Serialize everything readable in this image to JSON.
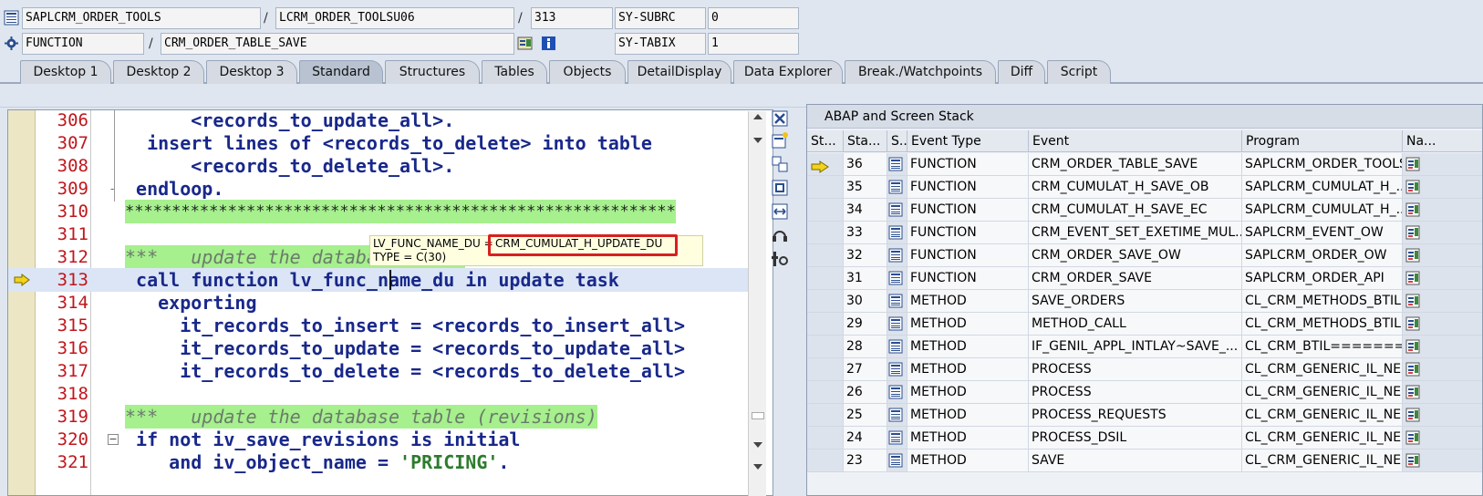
{
  "header": {
    "program": "SAPLCRM_ORDER_TOOLS",
    "include": "LCRM_ORDER_TOOLSU06",
    "line": "313",
    "subrc_label": "SY-SUBRC",
    "subrc_value": "0",
    "event_type": "FUNCTION",
    "event_name": "CRM_ORDER_TABLE_SAVE",
    "tabix_label": "SY-TABIX",
    "tabix_value": "1",
    "slash": "/"
  },
  "tabs": [
    {
      "label": "Desktop 1",
      "active": false
    },
    {
      "label": "Desktop 2",
      "active": false
    },
    {
      "label": "Desktop 3",
      "active": false
    },
    {
      "label": "Standard",
      "active": true
    },
    {
      "label": "Structures",
      "active": false
    },
    {
      "label": "Tables",
      "active": false
    },
    {
      "label": "Objects",
      "active": false
    },
    {
      "label": "DetailDisplay",
      "active": false
    },
    {
      "label": "Data Explorer",
      "active": false
    },
    {
      "label": "Break./Watchpoints",
      "active": false
    },
    {
      "label": "Diff",
      "active": false
    },
    {
      "label": "Script",
      "active": false
    }
  ],
  "editor": {
    "lines": [
      {
        "num": "306",
        "text": "      <records_to_update_all>."
      },
      {
        "num": "307",
        "text": "  insert lines of <records_to_delete> into table"
      },
      {
        "num": "308",
        "text": "      <records_to_delete_all>."
      },
      {
        "num": "309",
        "text": " endloop."
      },
      {
        "num": "310",
        "text": "***********************************************************"
      },
      {
        "num": "311",
        "text": ""
      },
      {
        "num": "312",
        "text": "***   update the database table"
      },
      {
        "num": "313",
        "text": " call function lv_func_name_du in update task"
      },
      {
        "num": "314",
        "text": "   exporting"
      },
      {
        "num": "315",
        "text": "     it_records_to_insert = <records_to_insert_all>"
      },
      {
        "num": "316",
        "text": "     it_records_to_update = <records_to_update_all>"
      },
      {
        "num": "317",
        "text": "     it_records_to_delete = <records_to_delete_all>"
      },
      {
        "num": "318",
        "text": ""
      },
      {
        "num": "319",
        "text": "***   update the database table (revisions)"
      },
      {
        "num": "320",
        "text": " if not iv_save_revisions is initial"
      },
      {
        "num": "321a",
        "text": "    and iv_object_name = "
      },
      {
        "num": "321b",
        "text": "'PRICING'"
      },
      {
        "num": "321c",
        "text": "."
      }
    ],
    "line_321": "321",
    "tooltip": {
      "name_label": "LV_FUNC_NAME_DU =",
      "name_value": "CRM_CUMULAT_H_UPDATE_DU",
      "type_label": "TYPE  = C(30)"
    }
  },
  "stack": {
    "title": "ABAP and Screen Stack",
    "columns": [
      "St...",
      "Sta...",
      "S..",
      "Event Type",
      "Event",
      "Program",
      "Na..."
    ],
    "rows": [
      {
        "level": "36",
        "type": "FUNCTION",
        "event": "CRM_ORDER_TABLE_SAVE",
        "program": "SAPLCRM_ORDER_TOOLS",
        "current": true
      },
      {
        "level": "35",
        "type": "FUNCTION",
        "event": "CRM_CUMULAT_H_SAVE_OB",
        "program": "SAPLCRM_CUMULAT_H_...",
        "current": false
      },
      {
        "level": "34",
        "type": "FUNCTION",
        "event": "CRM_CUMULAT_H_SAVE_EC",
        "program": "SAPLCRM_CUMULAT_H_...",
        "current": false
      },
      {
        "level": "33",
        "type": "FUNCTION",
        "event": "CRM_EVENT_SET_EXETIME_MUL...",
        "program": "SAPLCRM_EVENT_OW",
        "current": false
      },
      {
        "level": "32",
        "type": "FUNCTION",
        "event": "CRM_ORDER_SAVE_OW",
        "program": "SAPLCRM_ORDER_OW",
        "current": false
      },
      {
        "level": "31",
        "type": "FUNCTION",
        "event": "CRM_ORDER_SAVE",
        "program": "SAPLCRM_ORDER_API",
        "current": false
      },
      {
        "level": "30",
        "type": "METHOD",
        "event": "SAVE_ORDERS",
        "program": "CL_CRM_METHODS_BTIL...",
        "current": false
      },
      {
        "level": "29",
        "type": "METHOD",
        "event": "METHOD_CALL",
        "program": "CL_CRM_METHODS_BTIL...",
        "current": false
      },
      {
        "level": "28",
        "type": "METHOD",
        "event": "IF_GENIL_APPL_INTLAY~SAVE_...",
        "program": "CL_CRM_BTIL========...",
        "current": false
      },
      {
        "level": "27",
        "type": "METHOD",
        "event": "PROCESS",
        "program": "CL_CRM_GENERIC_IL_NE...",
        "current": false
      },
      {
        "level": "26",
        "type": "METHOD",
        "event": "PROCESS",
        "program": "CL_CRM_GENERIC_IL_NE...",
        "current": false
      },
      {
        "level": "25",
        "type": "METHOD",
        "event": "PROCESS_REQUESTS",
        "program": "CL_CRM_GENERIC_IL_NE...",
        "current": false
      },
      {
        "level": "24",
        "type": "METHOD",
        "event": "PROCESS_DSIL",
        "program": "CL_CRM_GENERIC_IL_NE...",
        "current": false
      },
      {
        "level": "23",
        "type": "METHOD",
        "event": "SAVE",
        "program": "CL_CRM_GENERIC_IL_NE...",
        "current": false
      }
    ]
  },
  "icons": {
    "program_icon": "document-list-icon",
    "function_icon": "gear-icon",
    "exec_arrow": "execution-pointer-icon",
    "display_icon": "display-detail-icon",
    "info_icon": "info-icon"
  }
}
